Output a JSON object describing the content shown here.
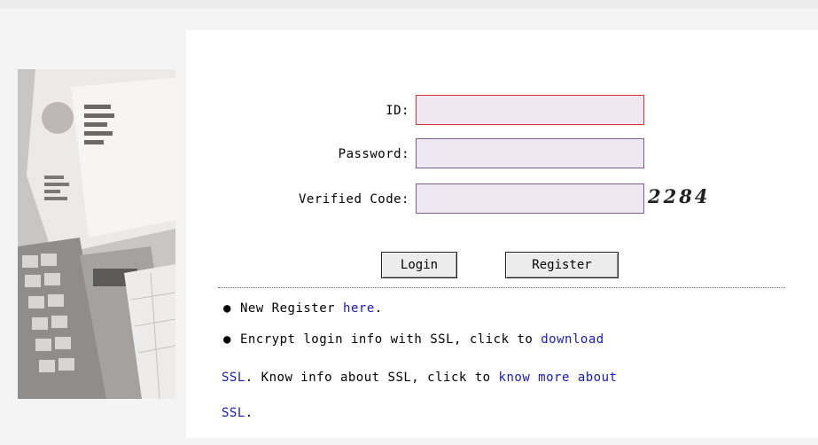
{
  "form": {
    "id_label": "ID:",
    "id_value": "",
    "password_label": "Password:",
    "password_value": "",
    "code_label": "Verified Code:",
    "code_value": "",
    "captcha": "2284"
  },
  "buttons": {
    "login": "Login",
    "register": "Register"
  },
  "info": {
    "bullet": "●",
    "line1_text": "New Register",
    "line1_link": "here",
    "line1_end": ".",
    "line2_text": "Encrypt login info with SSL, click to",
    "line2_link": "download",
    "line3_link": "SSL",
    "line3_mid": ". Know info about SSL, click to",
    "line3_link2": "know more about",
    "line4_link": "SSL",
    "line4_end": "."
  },
  "colors": {
    "link": "#1a1ab8",
    "field_bg": "#efe8f3",
    "field_border": "#7d5d8a",
    "active_border": "#e23333"
  }
}
